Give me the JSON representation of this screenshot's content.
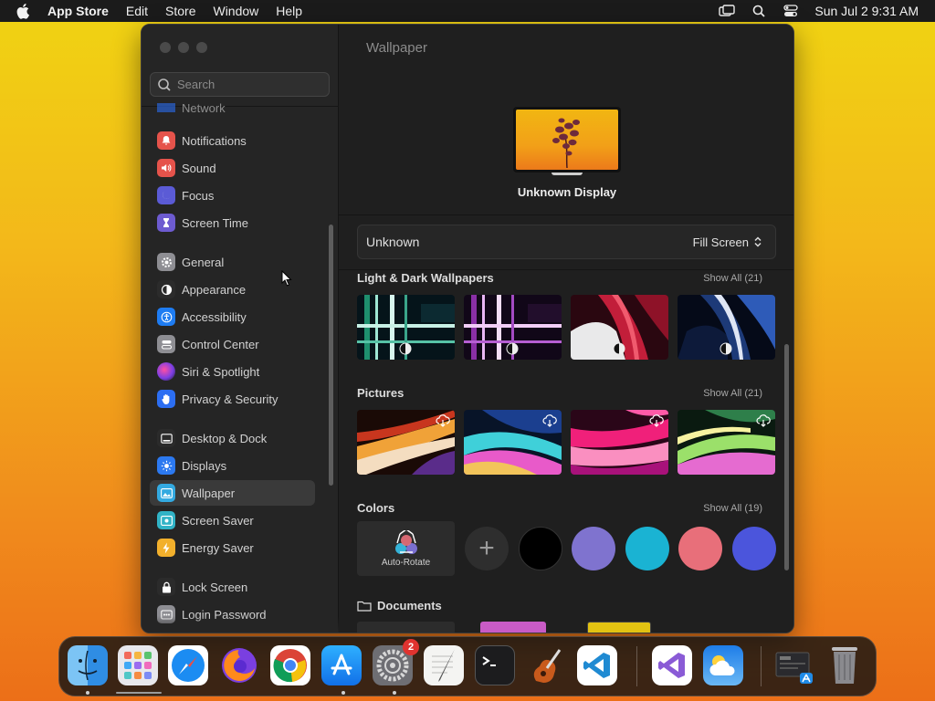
{
  "menubar": {
    "app_name": "App Store",
    "menus": [
      "Edit",
      "Store",
      "Window",
      "Help"
    ],
    "clock": "Sun Jul 2  9:31 AM"
  },
  "sidebar": {
    "search_placeholder": "Search",
    "partial_item": "Network",
    "items": [
      {
        "label": "Notifications",
        "icon": "bell-icon",
        "color": "#e5534b"
      },
      {
        "label": "Sound",
        "icon": "speaker-icon",
        "color": "#e5534b"
      },
      {
        "label": "Focus",
        "icon": "moon-icon",
        "color": "#5b5bd6"
      },
      {
        "label": "Screen Time",
        "icon": "hourglass-icon",
        "color": "#6d5bd0"
      },
      {
        "label": "General",
        "icon": "gear-icon",
        "color": "#8e8e93"
      },
      {
        "label": "Appearance",
        "icon": "appearance-icon",
        "color": "#2b2b2b"
      },
      {
        "label": "Accessibility",
        "icon": "accessibility-icon",
        "color": "#1e7cf2"
      },
      {
        "label": "Control Center",
        "icon": "control-center-icon",
        "color": "#8e8e93"
      },
      {
        "label": "Siri & Spotlight",
        "icon": "siri-icon",
        "color": "#b04ad8"
      },
      {
        "label": "Privacy & Security",
        "icon": "hand-icon",
        "color": "#2c6ef2"
      },
      {
        "label": "Desktop & Dock",
        "icon": "dock-icon",
        "color": "#2b2b2b"
      },
      {
        "label": "Displays",
        "icon": "sun-icon",
        "color": "#2c79f0"
      },
      {
        "label": "Wallpaper",
        "icon": "wallpaper-icon",
        "color": "#33a9e0"
      },
      {
        "label": "Screen Saver",
        "icon": "screensaver-icon",
        "color": "#31b3c6"
      },
      {
        "label": "Energy Saver",
        "icon": "battery-icon",
        "color": "#f2b02c"
      },
      {
        "label": "Lock Screen",
        "icon": "lock-icon",
        "color": "#2b2b2b"
      },
      {
        "label": "Login Password",
        "icon": "password-icon",
        "color": "#8e8e93"
      }
    ],
    "selected": "Wallpaper"
  },
  "content": {
    "title": "Wallpaper",
    "display_name": "Unknown Display",
    "wallpaper_name": "Unknown",
    "fit_option": "Fill Screen",
    "sections": {
      "light_dark": {
        "title": "Light & Dark Wallpapers",
        "show_all": "Show All (21)"
      },
      "pictures": {
        "title": "Pictures",
        "show_all": "Show All (21)"
      },
      "colors": {
        "title": "Colors",
        "show_all": "Show All (19)",
        "auto_rotate": "Auto-Rotate",
        "swatches": [
          "#000000",
          "#7f73cf",
          "#1ab3d3",
          "#e86f7a",
          "#4b55dc"
        ]
      },
      "documents": {
        "title": "Documents"
      }
    }
  },
  "dock": {
    "apps": [
      "Finder",
      "Launchpad",
      "Safari",
      "Firefox",
      "Chrome",
      "App Store",
      "System Settings",
      "TextEdit",
      "Terminal",
      "Instruments",
      "Visual Studio Code",
      "Visual Studio",
      "Weather",
      "Downloads",
      "Trash"
    ],
    "settings_badge": "2"
  }
}
